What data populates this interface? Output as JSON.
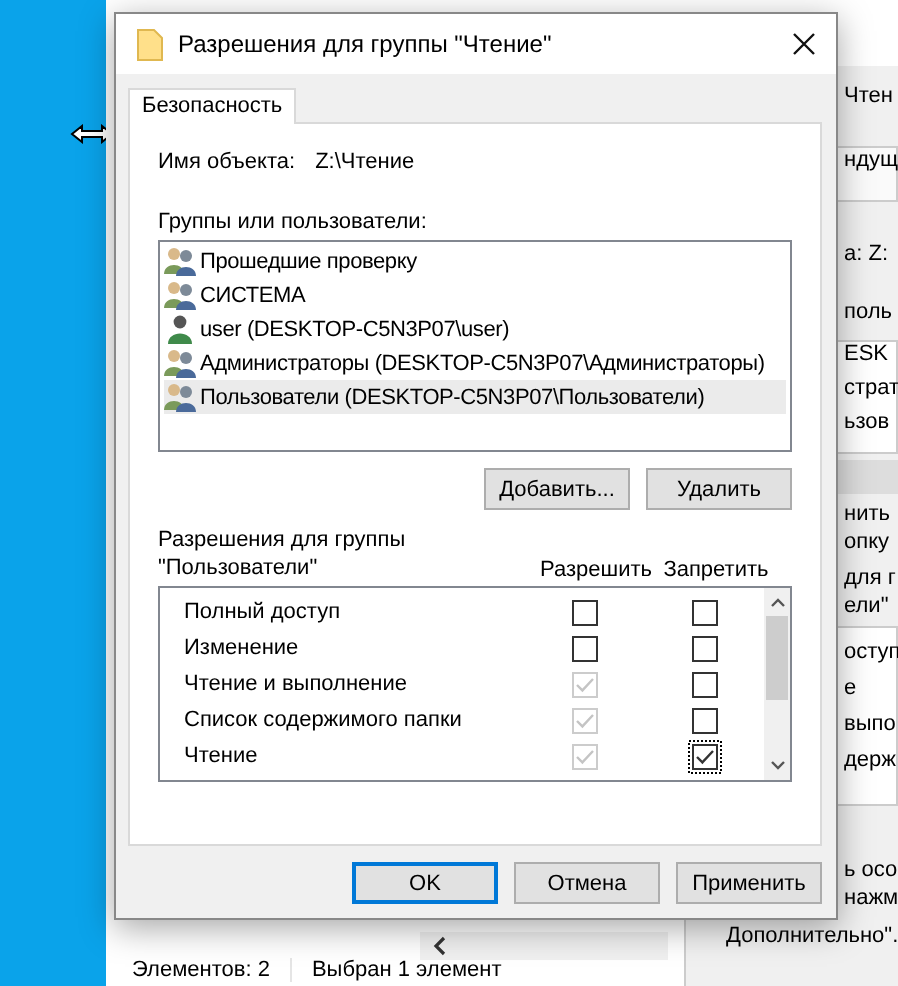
{
  "window": {
    "title": "Разрешения для группы \"Чтение\""
  },
  "tabs": [
    {
      "label": "Безопасность",
      "selected": true
    }
  ],
  "object_name": {
    "label": "Имя объекта:",
    "value": "Z:\\Чтение"
  },
  "groups": {
    "label": "Группы или пользователи:",
    "items": [
      {
        "name": "Прошедшие проверку",
        "kind": "group",
        "selected": false
      },
      {
        "name": "СИСТЕМА",
        "kind": "group",
        "selected": false
      },
      {
        "name": "user (DESKTOP-C5N3P07\\user)",
        "kind": "user",
        "selected": false
      },
      {
        "name": "Администраторы (DESKTOP-C5N3P07\\Администраторы)",
        "kind": "group",
        "selected": false
      },
      {
        "name": "Пользователи (DESKTOP-C5N3P07\\Пользователи)",
        "kind": "group",
        "selected": true
      }
    ],
    "buttons": [
      "Добавить...",
      "Удалить"
    ]
  },
  "permissions": {
    "label_lines": [
      "Разрешения для группы",
      "\"Пользователи\""
    ],
    "allow_header": "Разрешить",
    "deny_header": "Запретить",
    "rows": [
      {
        "name": "Полный доступ",
        "allow": {
          "checked": false,
          "disabled": false,
          "focused": false
        },
        "deny": {
          "checked": false,
          "disabled": false,
          "focused": false
        }
      },
      {
        "name": "Изменение",
        "allow": {
          "checked": false,
          "disabled": false,
          "focused": false
        },
        "deny": {
          "checked": false,
          "disabled": false,
          "focused": false
        }
      },
      {
        "name": "Чтение и выполнение",
        "allow": {
          "checked": true,
          "disabled": true,
          "focused": false
        },
        "deny": {
          "checked": false,
          "disabled": false,
          "focused": false
        }
      },
      {
        "name": "Список содержимого папки",
        "allow": {
          "checked": true,
          "disabled": true,
          "focused": false
        },
        "deny": {
          "checked": false,
          "disabled": false,
          "focused": false
        }
      },
      {
        "name": "Чтение",
        "allow": {
          "checked": true,
          "disabled": true,
          "focused": false
        },
        "deny": {
          "checked": true,
          "disabled": false,
          "focused": true
        }
      }
    ]
  },
  "buttons": [
    {
      "label": "OK",
      "default": true
    },
    {
      "label": "Отмена",
      "default": false
    },
    {
      "label": "Применить",
      "default": false
    }
  ],
  "background_window": {
    "fragments": [
      "Чтен",
      "ндущ",
      "а:  Z:",
      "поль",
      "ESK",
      "страт",
      "ьзов",
      "нить",
      "опку",
      "для г",
      "ели\"",
      "оступ",
      "е",
      "выпо",
      "держ",
      "ь осо",
      "нажм",
      "Дополнительно\"."
    ]
  },
  "explorer_status": [
    "Элементов: 2",
    "Выбран 1 элемент"
  ]
}
